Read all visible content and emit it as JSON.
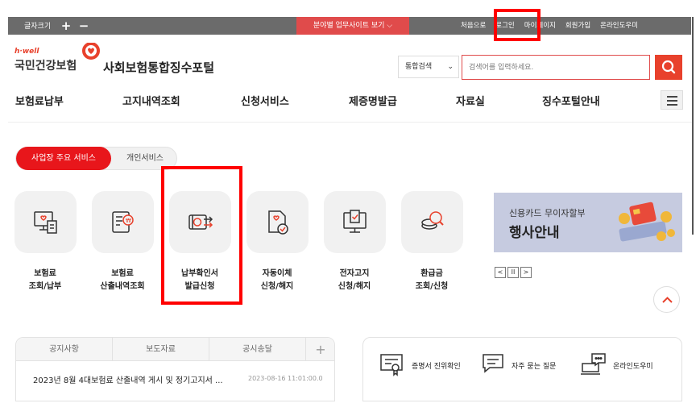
{
  "topbar": {
    "font_size_label": "글자크기",
    "plus": "+",
    "minus": "−",
    "field_sites_button": "분야별 업무사이트 보기 ⌵",
    "links": [
      "처음으로",
      "로그인",
      "마이페이지",
      "회원가입",
      "온라인도우미"
    ]
  },
  "header": {
    "logo_sub": "h·well",
    "logo_main": "국민건강보험",
    "site_title": "사회보험통합징수포털",
    "search_select": "통합검색",
    "search_placeholder": "검색어를 입력하세요."
  },
  "gnb": {
    "items": [
      "보험료납부",
      "고지내역조회",
      "신청서비스",
      "제증명발급",
      "자료실",
      "징수포털안내"
    ]
  },
  "service_tabs": {
    "active": "사업장 주요 서비스",
    "inactive": "개인서비스"
  },
  "services": [
    {
      "line1": "보험료",
      "line2": "조회/납부",
      "icon": "monitor-document-icon"
    },
    {
      "line1": "보험료",
      "line2": "산출내역조회",
      "icon": "list-coin-icon"
    },
    {
      "line1": "납부확인서",
      "line2": "발급신청",
      "icon": "card-arrow-icon"
    },
    {
      "line1": "자동이체",
      "line2": "신청/해지",
      "icon": "document-check-icon"
    },
    {
      "line1": "전자고지",
      "line2": "신청/해지",
      "icon": "monitor-check-icon"
    },
    {
      "line1": "환급금",
      "line2": "조회/신청",
      "icon": "coin-search-icon"
    }
  ],
  "banner": {
    "subtitle": "신용카드 무이자할부",
    "title": "행사안내",
    "controls": [
      "<",
      "II",
      ">"
    ]
  },
  "notice": {
    "tabs": [
      "공지사항",
      "보도자료",
      "공시송달",
      "+"
    ],
    "item_text": "2023년 8월 4대보험료 산출내역 게시 및 정기고지서 ...",
    "item_date": "2023-08-16 11:01:00.0"
  },
  "quick_links": [
    "증명서 진위확인",
    "자주 묻는 질문",
    "온라인도우미"
  ],
  "colors": {
    "brand_red": "#e8161b",
    "topbar_gray": "#6b6b6b",
    "highlight_box": "#ff0000"
  }
}
